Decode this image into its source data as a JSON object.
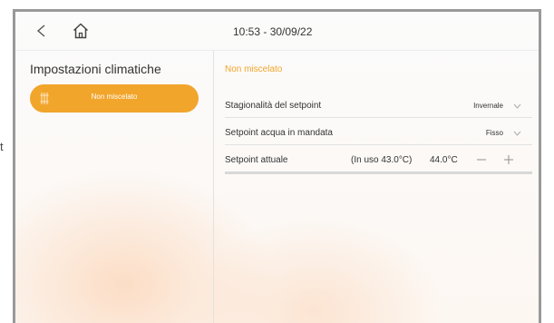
{
  "outer": {
    "fragment": "t"
  },
  "header": {
    "clock": "10:53 - 30/09/22",
    "icons": {
      "back": "chevron-left-icon",
      "home": "home-icon"
    }
  },
  "sidebar": {
    "title": "Impostazioni climatiche",
    "items": [
      {
        "label": "Non miscelato",
        "icon": "heating-radiator-icon",
        "active": true
      }
    ]
  },
  "main": {
    "section_title": "Non miscelato",
    "rows": [
      {
        "label": "Stagionalità del setpoint",
        "value": "Invernale"
      },
      {
        "label": "Setpoint acqua in mandata",
        "value": "Fisso"
      },
      {
        "label": "Setpoint attuale",
        "in_use": "(In uso 43.0°C)",
        "value": "44.0°C"
      }
    ]
  },
  "colors": {
    "accent": "#f1a52b",
    "text": "#333333",
    "divider": "#e2e2e2"
  }
}
